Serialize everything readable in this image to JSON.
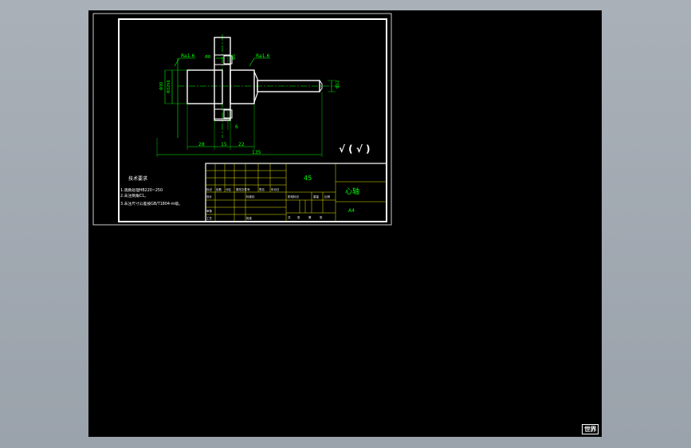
{
  "drawing": {
    "part_name": "心轴",
    "material": "45",
    "sheet_size": "A4",
    "roughness_symbol": "√ ( √ )",
    "dimensions": {
      "surface_finish_left": "Ra1.6",
      "surface_finish_right": "Ra1.6",
      "tolerance_top": "Φ8",
      "tolerance_hole": "Φ5",
      "dia_left": "Φ30",
      "dia_left_fit": "Φ32h6",
      "dia_right": "Φ12",
      "dim_28": "28",
      "dim_15": "15",
      "dim_22": "22",
      "dim_135": "135",
      "dim_6": "6"
    },
    "tech_requirements": {
      "title": "技术要求",
      "lines": [
        "1.调质处理HB220~250",
        "2.未注倒角C1。",
        "3.未注尺寸公差按GB/T1804-m级。"
      ]
    },
    "title_block": {
      "headers": [
        "标记",
        "处数",
        "分区",
        "更改文件号",
        "签名",
        "年月日"
      ],
      "rows": [
        "设计",
        "审核",
        "工艺",
        "标准化",
        "批准"
      ],
      "stage_labels": [
        "阶段标记",
        "重量",
        "比例"
      ],
      "sheet_labels": [
        "共",
        "张",
        "第",
        "张"
      ]
    }
  },
  "ui": {
    "ucs_label": "世界"
  }
}
